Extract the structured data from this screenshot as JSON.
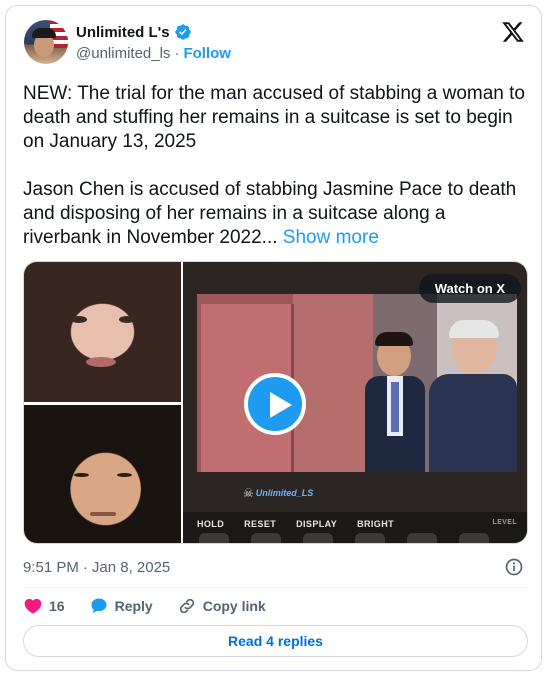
{
  "author": {
    "display_name": "Unlimited L's",
    "handle": "@unlimited_ls",
    "separator": "·",
    "follow_label": "Follow"
  },
  "tweet": {
    "paragraph1": "NEW: The trial for the man accused of stabbing a woman to death and stuffing her remains in a suitcase is set to begin on January 13, 2025",
    "paragraph2": "Jason Chen is accused of stabbing Jasmine Pace to death and disposing of her remains in a suitcase along a riverbank in November 2022...",
    "show_more": "Show more"
  },
  "media": {
    "watch_label": "Watch on X",
    "watermark": "Unlimited_LS",
    "panel_labels": [
      "HOLD",
      "RESET",
      "DISPLAY",
      "BRIGHT"
    ],
    "panel_level": "LEVEL"
  },
  "meta": {
    "time": "9:51 PM",
    "separator": "·",
    "date": "Jan 8, 2025"
  },
  "actions": {
    "likes": "16",
    "reply_label": "Reply",
    "copy_link_label": "Copy link"
  },
  "read_replies_label": "Read 4 replies",
  "colors": {
    "accent": "#1d9bf0",
    "like": "#f91880",
    "link_button": "#006fd6"
  }
}
